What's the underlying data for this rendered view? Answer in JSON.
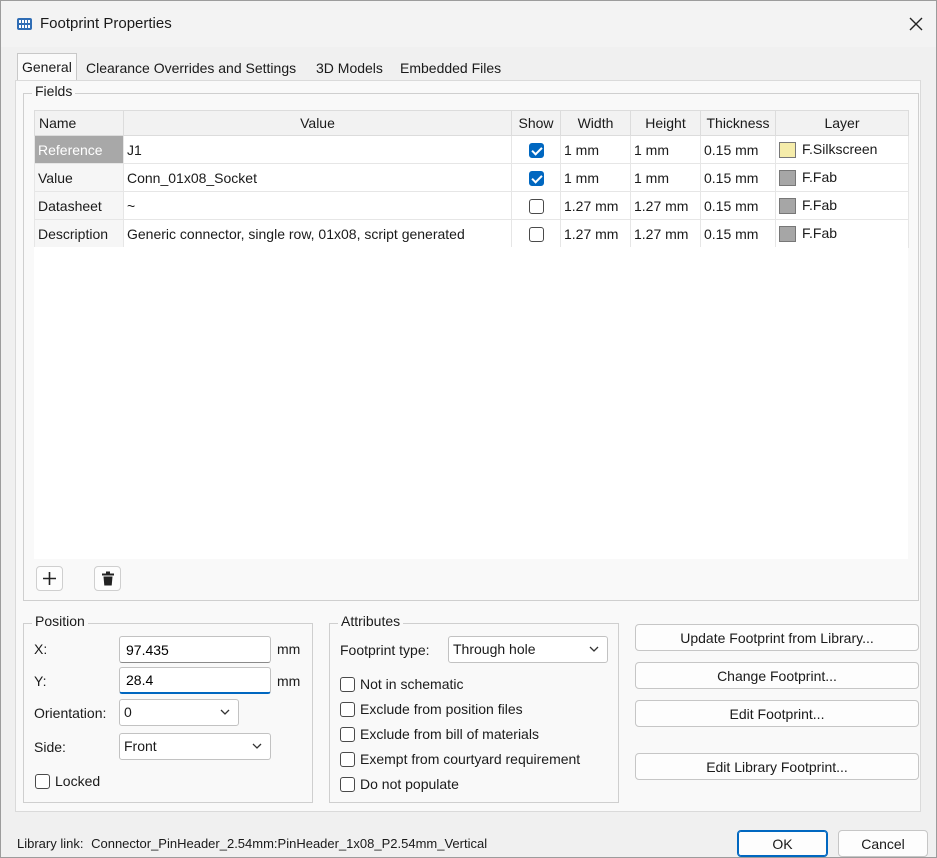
{
  "window": {
    "title": "Footprint Properties",
    "icon": "kicad-footprint-icon"
  },
  "tabs": [
    {
      "label": "General",
      "active": true
    },
    {
      "label": "Clearance Overrides and Settings",
      "active": false
    },
    {
      "label": "3D Models",
      "active": false
    },
    {
      "label": "Embedded Files",
      "active": false
    }
  ],
  "fields": {
    "legend": "Fields",
    "columns": [
      "Name",
      "Value",
      "Show",
      "Width",
      "Height",
      "Thickness",
      "Layer"
    ],
    "rows": [
      {
        "name": "Reference",
        "value": "J1",
        "show": true,
        "width": "1 mm",
        "height": "1 mm",
        "thickness": "0.15 mm",
        "layer": "F.Silkscreen",
        "layer_color": "#f5ecaa",
        "selected": true
      },
      {
        "name": "Value",
        "value": "Conn_01x08_Socket",
        "show": true,
        "width": "1 mm",
        "height": "1 mm",
        "thickness": "0.15 mm",
        "layer": "F.Fab",
        "layer_color": "#a6a6a6",
        "selected": false
      },
      {
        "name": "Datasheet",
        "value": "~",
        "show": false,
        "width": "1.27 mm",
        "height": "1.27 mm",
        "thickness": "0.15 mm",
        "layer": "F.Fab",
        "layer_color": "#a6a6a6",
        "selected": false
      },
      {
        "name": "Description",
        "value": "Generic connector, single row, 01x08, script generated",
        "show": false,
        "width": "1.27 mm",
        "height": "1.27 mm",
        "thickness": "0.15 mm",
        "layer": "F.Fab",
        "layer_color": "#a6a6a6",
        "selected": false
      }
    ]
  },
  "position": {
    "legend": "Position",
    "x_label": "X:",
    "x_value": "97.435",
    "x_unit": "mm",
    "y_label": "Y:",
    "y_value": "28.4",
    "y_unit": "mm",
    "orientation_label": "Orientation:",
    "orientation_value": "0",
    "side_label": "Side:",
    "side_value": "Front",
    "locked_label": "Locked",
    "locked": false
  },
  "attributes": {
    "legend": "Attributes",
    "type_label": "Footprint type:",
    "type_value": "Through hole",
    "checks": [
      {
        "label": "Not in schematic",
        "checked": false
      },
      {
        "label": "Exclude from position files",
        "checked": false
      },
      {
        "label": "Exclude from bill of materials",
        "checked": false
      },
      {
        "label": "Exempt from courtyard requirement",
        "checked": false
      },
      {
        "label": "Do not populate",
        "checked": false
      }
    ]
  },
  "actions": {
    "update": "Update Footprint from Library...",
    "change": "Change Footprint...",
    "edit": "Edit Footprint...",
    "edit_library": "Edit Library Footprint..."
  },
  "footer": {
    "library_link_label": "Library link:",
    "library_link_value": "Connector_PinHeader_2.54mm:PinHeader_1x08_P2.54mm_Vertical",
    "ok": "OK",
    "cancel": "Cancel"
  },
  "colors": {
    "accent": "#0067c0",
    "selected_row": "#a8a8a8"
  }
}
